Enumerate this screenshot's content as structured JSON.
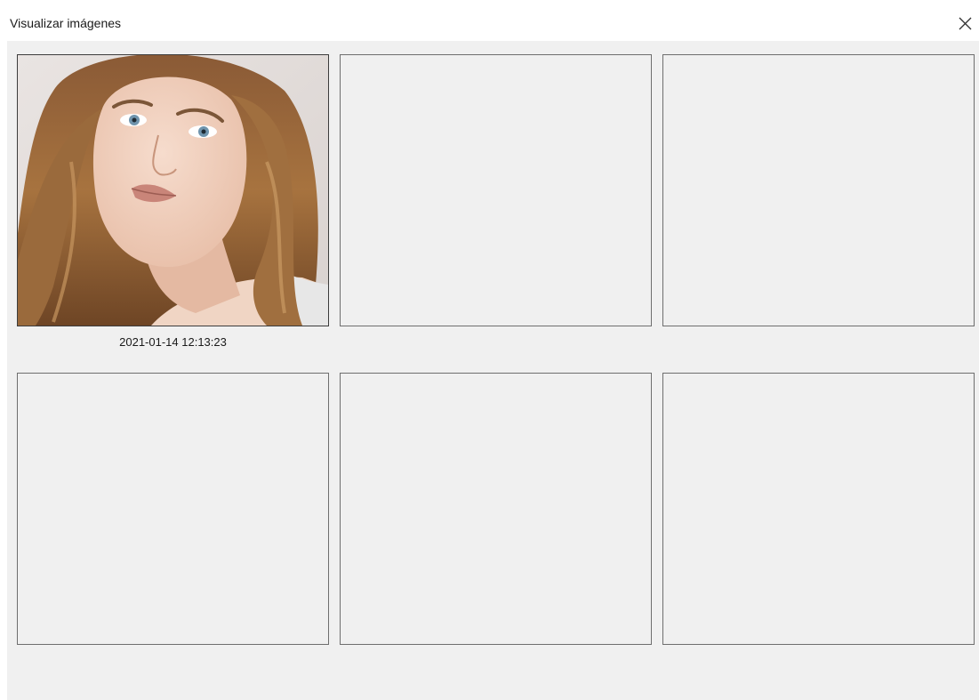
{
  "window": {
    "title": "Visualizar imágenes",
    "close_icon": "close-icon"
  },
  "gallery": {
    "tiles": [
      {
        "has_image": true,
        "image": "portrait-photo",
        "caption": "2021-01-14 12:13:23"
      },
      {
        "has_image": false
      },
      {
        "has_image": false
      },
      {
        "has_image": false
      },
      {
        "has_image": false
      },
      {
        "has_image": false
      }
    ]
  },
  "colors": {
    "content_background": "#f0f0f0",
    "tile_border": "#6e6e6e",
    "text": "#1a1a1a"
  }
}
